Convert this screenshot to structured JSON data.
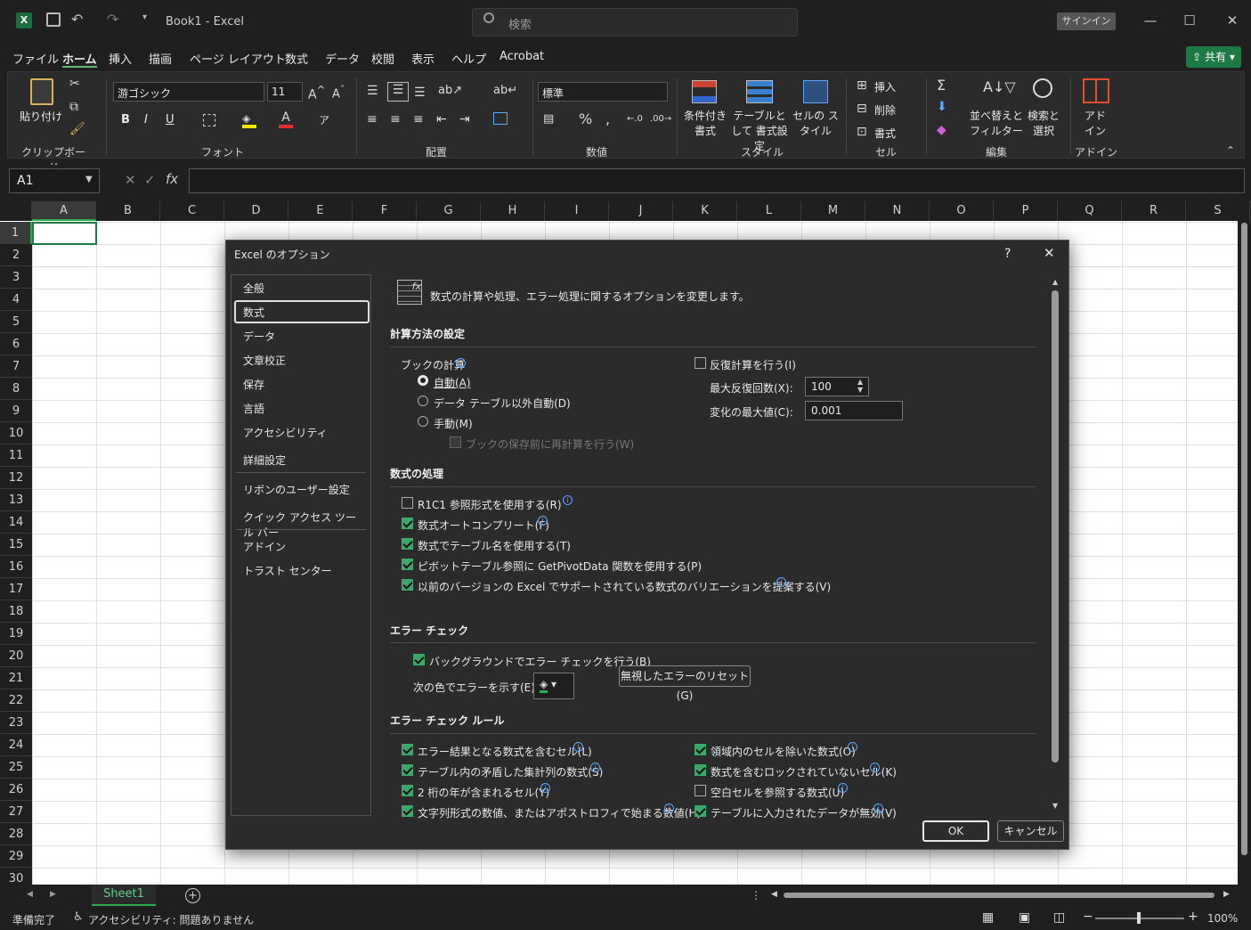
{
  "title": {
    "doc": "Book1 - Excel",
    "search_placeholder": "検索",
    "signin": "サインイン"
  },
  "menu": [
    "ファイル",
    "ホーム",
    "挿入",
    "描画",
    "ページ レイアウト",
    "数式",
    "データ",
    "校閲",
    "表示",
    "ヘルプ",
    "Acrobat"
  ],
  "share_label": "共有",
  "ribbon": {
    "paste": "貼り付け",
    "font_name": "游ゴシック",
    "font_size": "11",
    "number_format": "標準",
    "cond_format": "条件付き 書式",
    "table_format": "テーブルとして 書式設定",
    "cell_style": "セルの スタイル",
    "insert": "挿入",
    "delete": "削除",
    "format": "書式",
    "sort_filter": "並べ替えと フィルター",
    "find_select": "検索と 選択",
    "addin": "アド イン",
    "groups": {
      "clipboard": "クリップボード",
      "font": "フォント",
      "align": "配置",
      "number": "数値",
      "style": "スタイル",
      "cell": "セル",
      "edit": "編集",
      "addin": "アドイン"
    }
  },
  "namebox": "A1",
  "columns": [
    "A",
    "B",
    "C",
    "D",
    "E",
    "F",
    "G",
    "H",
    "I",
    "J",
    "K",
    "L",
    "M",
    "N",
    "O",
    "P",
    "Q",
    "R",
    "S"
  ],
  "rows": [
    "1",
    "2",
    "3",
    "4",
    "5",
    "6",
    "7",
    "8",
    "9",
    "10",
    "11",
    "12",
    "13",
    "14",
    "15",
    "16",
    "17",
    "18",
    "19",
    "20",
    "21",
    "22",
    "23",
    "24",
    "25",
    "26",
    "27",
    "28",
    "29",
    "30"
  ],
  "dialog": {
    "title": "Excel のオプション",
    "help": "?",
    "nav": [
      "全般",
      "数式",
      "データ",
      "文章校正",
      "保存",
      "言語",
      "アクセシビリティ",
      "詳細設定",
      "リボンのユーザー設定",
      "クイック アクセス ツール バー",
      "アドイン",
      "トラスト センター"
    ],
    "header": "数式の計算や処理、エラー処理に関するオプションを変更します。",
    "calc": {
      "section": "計算方法の設定",
      "book_calc": "ブックの計算",
      "auto": "自動(A)",
      "auto_except_table": "データ テーブル以外自動(D)",
      "manual": "手動(M)",
      "recalc_before_save": "ブックの保存前に再計算を行う(W)",
      "iterative": "反復計算を行う(I)",
      "max_iter_label": "最大反復回数(X):",
      "max_iter_value": "100",
      "max_change_label": "変化の最大値(C):",
      "max_change_value": "0.001"
    },
    "formulas": {
      "section": "数式の処理",
      "items": [
        {
          "label": "R1C1 参照形式を使用する(R)",
          "checked": false,
          "info": true
        },
        {
          "label": "数式オートコンプリート(F)",
          "checked": true,
          "info": true
        },
        {
          "label": "数式でテーブル名を使用する(T)",
          "checked": true,
          "info": false
        },
        {
          "label": "ピボットテーブル参照に GetPivotData 関数を使用する(P)",
          "checked": true,
          "info": false
        },
        {
          "label": "以前のバージョンの Excel でサポートされている数式のバリエーションを提案する(V)",
          "checked": true,
          "info": true
        }
      ]
    },
    "errcheck": {
      "section": "エラー チェック",
      "background": "バックグラウンドでエラー チェックを行う(B)",
      "color_label": "次の色でエラーを示す(E):",
      "reset_btn": "無視したエラーのリセット(G)"
    },
    "rules": {
      "section": "エラー チェック ルール",
      "left": [
        {
          "label": "エラー結果となる数式を含むセル(L)",
          "checked": true
        },
        {
          "label": "テーブル内の矛盾した集計列の数式(S)",
          "checked": true
        },
        {
          "label": "2 桁の年が含まれるセル(Y)",
          "checked": true
        },
        {
          "label": "文字列形式の数値、またはアポストロフィで始まる数値(H)",
          "checked": true
        }
      ],
      "right": [
        {
          "label": "領域内のセルを除いた数式(O)",
          "checked": true
        },
        {
          "label": "数式を含むロックされていないセル(K)",
          "checked": true
        },
        {
          "label": "空白セルを参照する数式(U)",
          "checked": false
        },
        {
          "label": "テーブルに入力されたデータが無効(V)",
          "checked": true
        }
      ]
    },
    "ok": "OK",
    "cancel": "キャンセル"
  },
  "sheet_tab": "Sheet1",
  "status": {
    "ready": "準備完了",
    "accessibility": "アクセシビリティ: 問題ありません",
    "zoom": "100%"
  }
}
